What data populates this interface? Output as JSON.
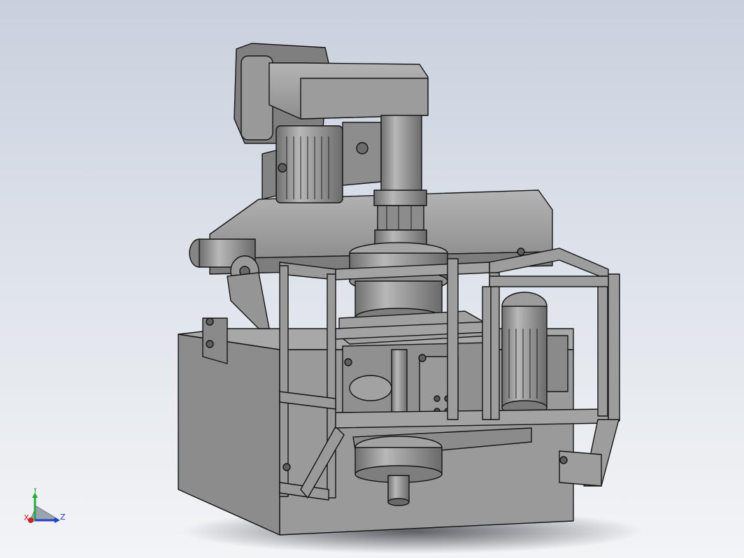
{
  "viewport": {
    "background_top": "#c9d0dd",
    "background_bottom": "#f3f4f6",
    "model_fill": "#8f8f8f",
    "edge_color": "#141414"
  },
  "triad": {
    "x_label": "X",
    "y_label": "Y",
    "z_label": "Z",
    "x_color": "#d21f1f",
    "y_color": "#1fae3a",
    "z_color": "#1f3fd2"
  }
}
